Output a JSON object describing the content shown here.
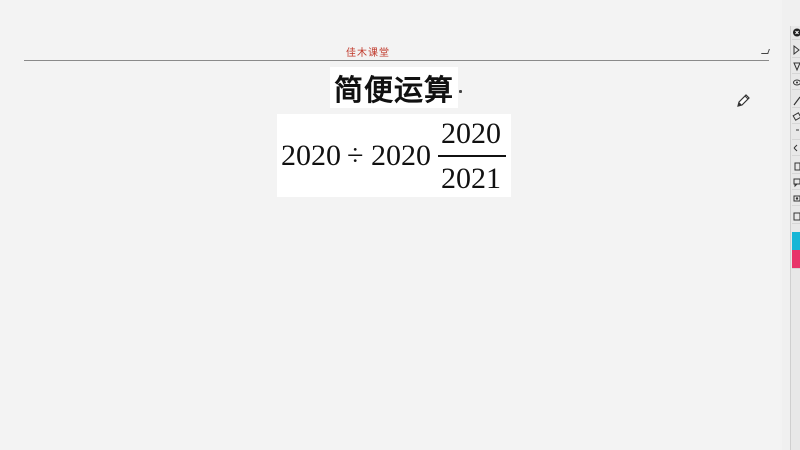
{
  "header": {
    "brand": "佳木课堂"
  },
  "slide": {
    "title": "简便运算",
    "formula": {
      "dividend": "2020",
      "operator": "÷",
      "whole": "2020",
      "numerator": "2020",
      "denominator": "2021"
    }
  },
  "toolbar": {
    "tools": [
      {
        "icon": "close-icon"
      },
      {
        "icon": "select-arrow-icon"
      },
      {
        "icon": "triangle-icon"
      },
      {
        "icon": "eye-icon"
      },
      {
        "icon": "pen-icon"
      },
      {
        "icon": "eraser-icon"
      },
      {
        "icon": "line-icon"
      },
      {
        "icon": "undo-icon"
      },
      {
        "icon": "copy-icon"
      },
      {
        "icon": "comment-icon"
      },
      {
        "icon": "camera-icon"
      },
      {
        "icon": "page-icon"
      },
      {
        "icon": "color-cyan-swatch",
        "color": "#17b6d6"
      },
      {
        "icon": "color-red-swatch",
        "color": "#e8356a"
      }
    ]
  }
}
